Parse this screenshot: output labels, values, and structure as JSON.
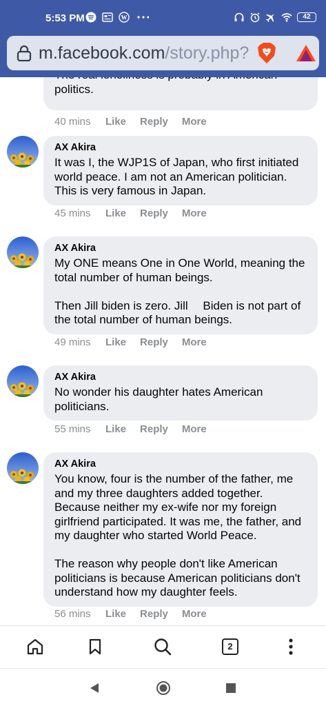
{
  "status_bar": {
    "time": "5:53 PM",
    "battery": "42",
    "left_icons": [
      "spotify-icon",
      "news-icon",
      "wordpress-icon",
      "more-dots-icon"
    ],
    "right_icons": [
      "headset-icon",
      "alarm-icon",
      "airplane-icon",
      "wifi-icon",
      "battery-icon"
    ]
  },
  "browser": {
    "url_domain": "m.facebook.com",
    "url_path": "/story.php?",
    "tab_count": "2"
  },
  "comments": [
    {
      "author": "",
      "text": "The real loneliness is probably in American\npolitics.",
      "time": "40 mins"
    },
    {
      "author": "AX Akira",
      "text": "It was I, the WJP1S of Japan, who first initiated world peace. I am not an American politician. This is very famous in Japan.",
      "time": "45 mins"
    },
    {
      "author": "AX Akira",
      "text": "My ONE means One in One World, meaning the total number of human beings.\n\nThen Jill biden is zero. Jill　 Biden is not part of the total number of human beings.",
      "time": "49 mins"
    },
    {
      "author": "AX Akira",
      "text": "No wonder his daughter hates American politicians.",
      "time": "55 mins"
    },
    {
      "author": "AX Akira",
      "text": "You know, four is the number of the father, me and my three daughters added together. Because neither my ex-wife nor my foreign girlfriend participated. It was me, the father, and my daughter who started World Peace.\n\nThe reason why people don't like American politicians is because American politicians don't understand how my daughter feels.",
      "time": "56 mins"
    }
  ],
  "actions": {
    "like": "Like",
    "reply": "Reply",
    "more": "More"
  },
  "colors": {
    "header_blue": "#3e5aa6",
    "bubble_gray": "#ebedf0",
    "meta_gray": "#8a8d91"
  }
}
